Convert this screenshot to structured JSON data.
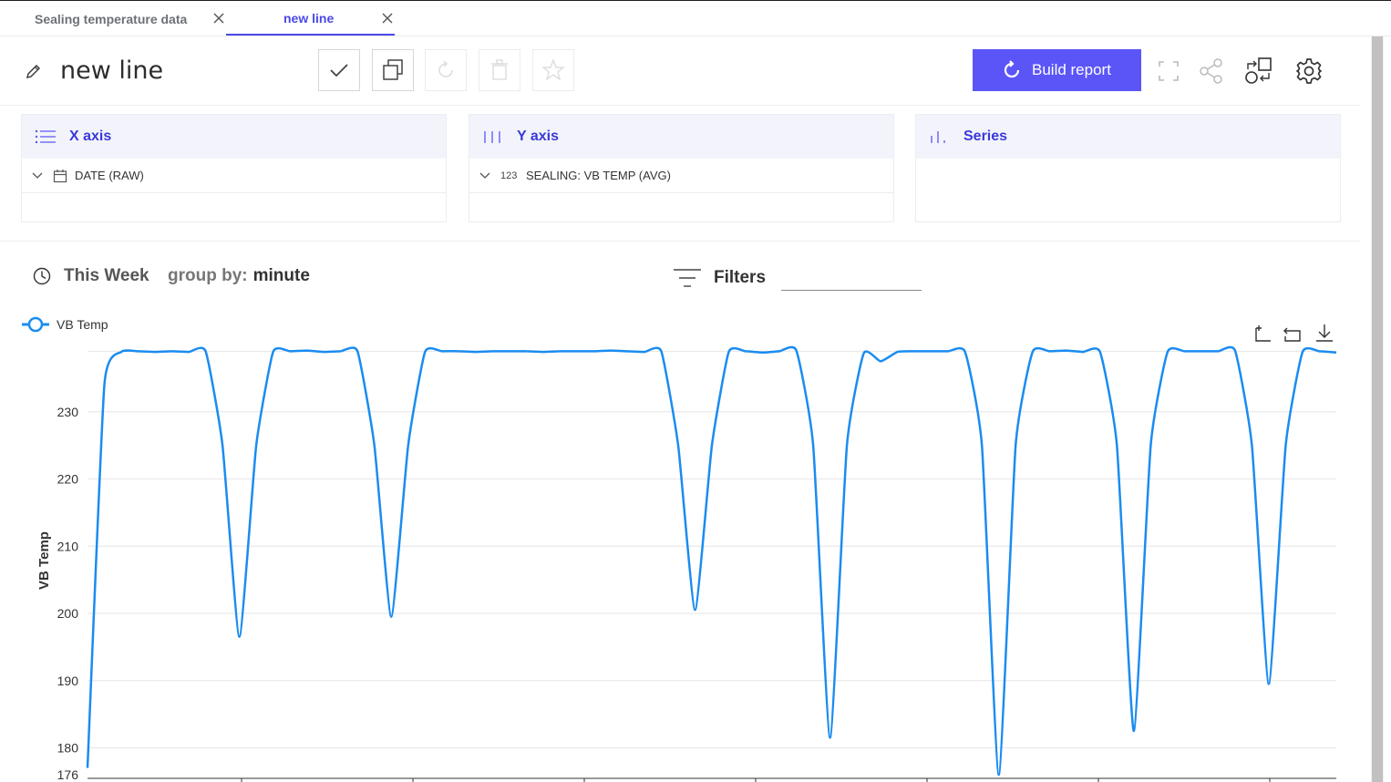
{
  "tabs": [
    {
      "label": "Sealing temperature data",
      "active": false
    },
    {
      "label": "new line",
      "active": true
    }
  ],
  "report": {
    "title": "new line",
    "build_label": "Build report"
  },
  "panels": {
    "x_axis": {
      "title": "X axis",
      "field": "DATE (RAW)"
    },
    "y_axis": {
      "title": "Y axis",
      "field": "SEALING: VB TEMP (AVG)",
      "type_glyph": "123"
    },
    "series": {
      "title": "Series"
    }
  },
  "controls": {
    "period": "This Week",
    "group_by_label": "group by:",
    "group_by_value": "minute",
    "filters_label": "Filters"
  },
  "colors": {
    "accent": "#5b55f8",
    "link": "#3b39d8",
    "series": "#1a8cf0"
  },
  "chart_data": {
    "type": "line",
    "legend": [
      "VB Temp"
    ],
    "ylabel": "VB Temp",
    "ylim": [
      176,
      240
    ],
    "yticks": [
      176,
      180,
      190,
      200,
      210,
      220,
      230
    ],
    "grid": true,
    "legend_position": "top-left",
    "series": [
      {
        "name": "VB Temp",
        "values": [
          177,
          234,
          238.9,
          239,
          238.9,
          239,
          238.9,
          239,
          225,
          196.5,
          225,
          238.9,
          239,
          239.1,
          238.9,
          239,
          239,
          225,
          199.5,
          225,
          238.9,
          239,
          239,
          238.9,
          239,
          239,
          239,
          238.9,
          239,
          239,
          239,
          239.1,
          239,
          238.9,
          239,
          225,
          200.5,
          225,
          238.9,
          239,
          238.8,
          239,
          239.1,
          225,
          181.5,
          225,
          238.7,
          237.5,
          238.9,
          239,
          239,
          239,
          238.9,
          225,
          176,
          225,
          238.9,
          239,
          239.1,
          238.9,
          238.9,
          225,
          182.5,
          225,
          238.9,
          239,
          239,
          239,
          239.1,
          225,
          189.5,
          225,
          238.9,
          239,
          238.8
        ]
      }
    ]
  }
}
